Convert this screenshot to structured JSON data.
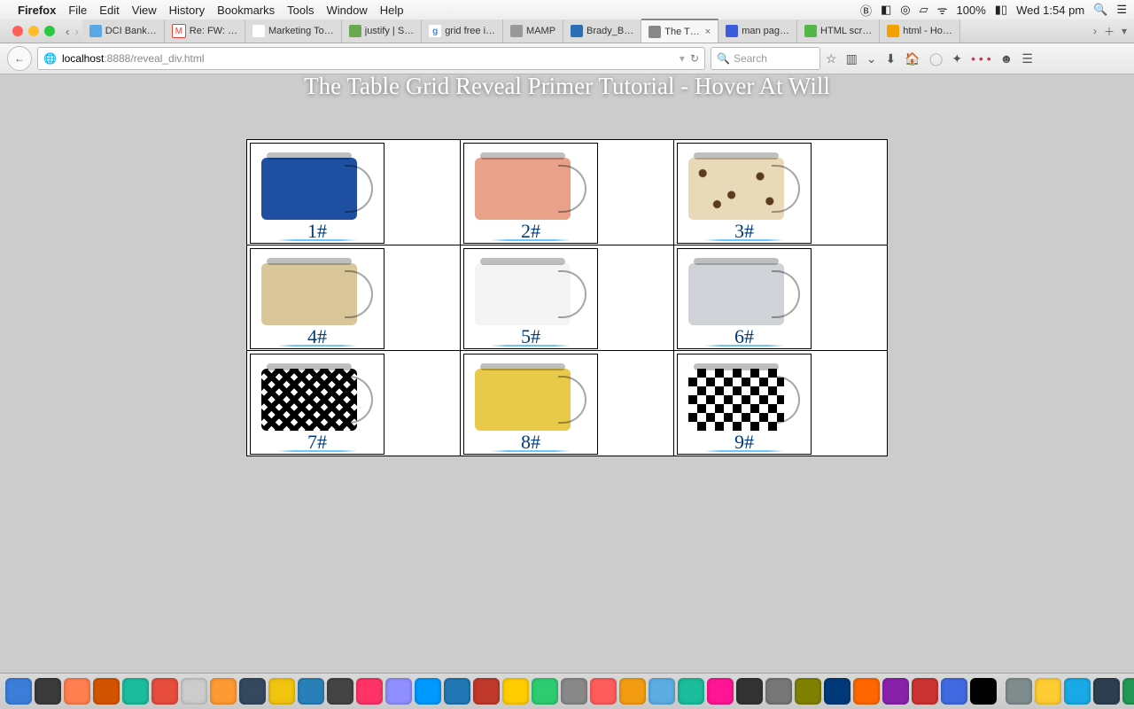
{
  "menubar": {
    "app": "Firefox",
    "items": [
      "File",
      "Edit",
      "View",
      "History",
      "Bookmarks",
      "Tools",
      "Window",
      "Help"
    ],
    "battery": "100%",
    "clock": "Wed 1:54 pm"
  },
  "tabs": [
    {
      "label": "DCI Bank…",
      "fav": "#5aa9e6"
    },
    {
      "label": "Re: FW: …",
      "fav": "#ea4335"
    },
    {
      "label": "Marketing To…",
      "fav": "#ffffff"
    },
    {
      "label": "justify | S…",
      "fav": "#6aa84f"
    },
    {
      "label": "grid free i…",
      "fav": "#4285f4"
    },
    {
      "label": "MAMP",
      "fav": "#999999"
    },
    {
      "label": "Brady_B…",
      "fav": "#2a6fb5"
    },
    {
      "label": "The T…",
      "fav": "#888888",
      "active": true,
      "closeable": true
    },
    {
      "label": "man pag…",
      "fav": "#3b5bdb"
    },
    {
      "label": "HTML scr…",
      "fav": "#51b749"
    },
    {
      "label": "html - Ho…",
      "fav": "#f4a000"
    }
  ],
  "url": {
    "host": "localhost",
    "port": ":8888",
    "path": "/reveal_div.html"
  },
  "search": {
    "placeholder": "Search"
  },
  "page": {
    "title": "The Table Grid Reveal Primer Tutorial - Hover At Will",
    "cells": [
      {
        "num": "1#",
        "bag_color": "#1f4fa0",
        "quilt": true
      },
      {
        "num": "2#",
        "bag_color": "#e9a18a",
        "quilt": true
      },
      {
        "num": "3#",
        "bag_color": "leopard"
      },
      {
        "num": "4#",
        "bag_color": "#d9c79a",
        "quilt": true
      },
      {
        "num": "5#",
        "bag_color": "#f4f4f4",
        "quilt": true
      },
      {
        "num": "6#",
        "bag_color": "#cfd3d8",
        "quilt": true
      },
      {
        "num": "7#",
        "bag_color": "hound"
      },
      {
        "num": "8#",
        "bag_color": "#e8c94a",
        "quilt": true
      },
      {
        "num": "9#",
        "bag_color": "checker"
      }
    ]
  },
  "dock_colors": [
    "#3b7dd8",
    "#3a3a3a",
    "#ff7f50",
    "#d35400",
    "#1abc9c",
    "#e74c3c",
    "#cccccc",
    "#ff9933",
    "#34495e",
    "#f1c40f",
    "#2980b9",
    "#444444",
    "#ff3366",
    "#8f8fff",
    "#0099ff",
    "#1f77b4",
    "#c0392b",
    "#ffcc00",
    "#2ecc71",
    "#888888",
    "#ff5c5c",
    "#f39c12",
    "#5dade2",
    "#1abc9c",
    "#ff1493",
    "#333333",
    "#777777",
    "#808000",
    "#003a7a",
    "#ff6600",
    "#8922aa",
    "#cc3333",
    "#4169e1",
    "#000000",
    "#7f8c8d",
    "#ffcc33",
    "#19a9e6",
    "#2d3e50",
    "#229954",
    "#cc5500",
    "#eeeeee"
  ]
}
